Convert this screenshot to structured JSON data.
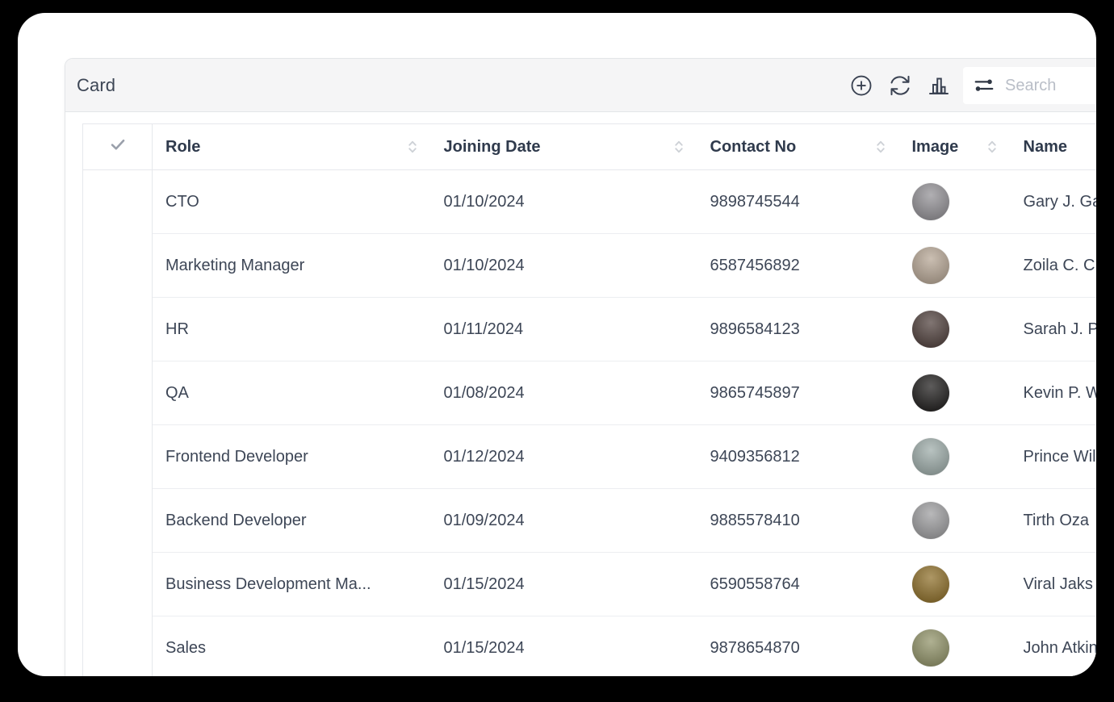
{
  "card": {
    "title": "Card",
    "toolbar": {
      "add_label": "add-record",
      "refresh_label": "refresh",
      "chart_label": "chart",
      "filter_label": "filter"
    },
    "search": {
      "placeholder": "Search",
      "value": ""
    }
  },
  "table": {
    "columns": [
      {
        "key": "select",
        "label": "",
        "sortable": false
      },
      {
        "key": "role",
        "label": "Role",
        "sortable": true
      },
      {
        "key": "date",
        "label": "Joining Date",
        "sortable": true
      },
      {
        "key": "phone",
        "label": "Contact No",
        "sortable": true
      },
      {
        "key": "image",
        "label": "Image",
        "sortable": true
      },
      {
        "key": "name",
        "label": "Name",
        "sortable": false
      }
    ],
    "rows": [
      {
        "role": "CTO",
        "date": "01/10/2024",
        "phone": "9898745544",
        "name": "Gary J. Ga",
        "avatar": "#8f8d92"
      },
      {
        "role": "Marketing Manager",
        "date": "01/10/2024",
        "phone": "6587456892",
        "name": "Zoila C. C",
        "avatar": "#b4a391"
      },
      {
        "role": "HR",
        "date": "01/11/2024",
        "phone": "9896584123",
        "name": "Sarah J. P",
        "avatar": "#4a3a36"
      },
      {
        "role": "QA",
        "date": "01/08/2024",
        "phone": "9865745897",
        "name": "Kevin P. W",
        "avatar": "#171514"
      },
      {
        "role": "Frontend Developer",
        "date": "01/12/2024",
        "phone": "9409356812",
        "name": "Prince Wil",
        "avatar": "#9aa9a6"
      },
      {
        "role": "Backend Developer",
        "date": "01/09/2024",
        "phone": "9885578410",
        "name": "Tirth Oza",
        "avatar": "#9a9a9c"
      },
      {
        "role": "Business Development Ma...",
        "date": "01/15/2024",
        "phone": "6590558764",
        "name": "Viral Jaks",
        "avatar": "#8a6a22"
      },
      {
        "role": "Sales",
        "date": "01/15/2024",
        "phone": "9878654870",
        "name": "John Atkin",
        "avatar": "#8d8f63"
      }
    ]
  },
  "colors": {
    "header_bg": "#f5f5f6",
    "text": "#3d4656",
    "heading_text": "#2f3a4c",
    "border": "#e6e8ec",
    "placeholder": "#b9bec7",
    "frame": "#000000"
  }
}
